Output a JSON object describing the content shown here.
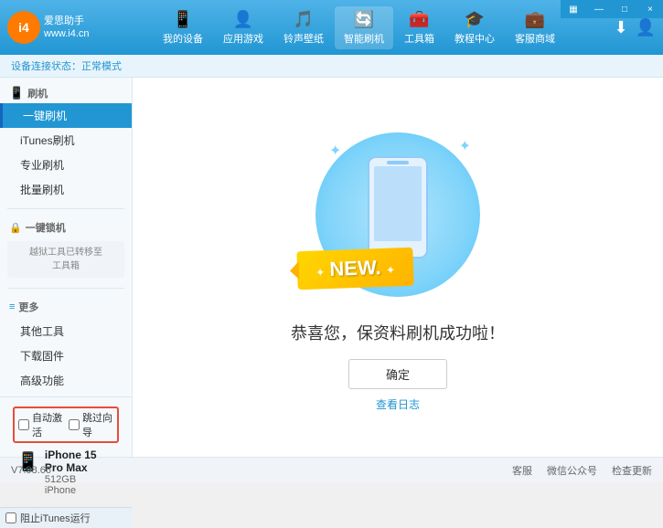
{
  "app": {
    "logo_text_line1": "爱思助手",
    "logo_text_line2": "www.i4.cn",
    "logo_abbr": "i4"
  },
  "nav": {
    "items": [
      {
        "id": "my-device",
        "label": "我的设备",
        "icon": "📱"
      },
      {
        "id": "apps-games",
        "label": "应用游戏",
        "icon": "👤"
      },
      {
        "id": "ringtones",
        "label": "铃声壁纸",
        "icon": "🎵"
      },
      {
        "id": "smart-flash",
        "label": "智能刷机",
        "icon": "🔄"
      },
      {
        "id": "toolbox",
        "label": "工具箱",
        "icon": "🧰"
      },
      {
        "id": "tutorials",
        "label": "教程中心",
        "icon": "🎓"
      },
      {
        "id": "service",
        "label": "客服商域",
        "icon": "💼"
      }
    ]
  },
  "window_controls": {
    "minimize": "—",
    "maximize": "□",
    "close": "×"
  },
  "breadcrumb": {
    "prefix": "设备连接状态：",
    "status": "正常模式"
  },
  "sidebar": {
    "flash_section": {
      "label": "刷机",
      "icon": "📱"
    },
    "items": [
      {
        "id": "one-click-flash",
        "label": "一键刷机",
        "active": true
      },
      {
        "id": "itunes-flash",
        "label": "iTunes刷机",
        "active": false
      },
      {
        "id": "pro-flash",
        "label": "专业刷机",
        "active": false
      },
      {
        "id": "batch-flash",
        "label": "批量刷机",
        "active": false
      }
    ],
    "notice_section": {
      "icon": "🔒",
      "label": "一键锁机",
      "notice_text": "越狱工具已转移至\n工具箱"
    },
    "more_section": {
      "label": "更多",
      "icon": "≡"
    },
    "more_items": [
      {
        "id": "other-tools",
        "label": "其他工具"
      },
      {
        "id": "download-firmware",
        "label": "下载固件"
      },
      {
        "id": "advanced",
        "label": "高级功能"
      }
    ],
    "auto_row": {
      "auto_activate": "自动激活",
      "auto_export": "跳过向导"
    },
    "device": {
      "name": "iPhone 15 Pro Max",
      "storage": "512GB",
      "type": "iPhone",
      "icon": "📱"
    },
    "itunes_bar": {
      "label": "阻止iTunes运行"
    }
  },
  "content": {
    "new_badge": "NEW.",
    "success_message": "恭喜您，保资料刷机成功啦！",
    "confirm_button": "确定",
    "view_log": "查看日志"
  },
  "footer": {
    "version": "V7.98.66",
    "links": [
      {
        "id": "customer",
        "label": "客服"
      },
      {
        "id": "wechat",
        "label": "微信公众号"
      },
      {
        "id": "check-update",
        "label": "检查更新"
      }
    ]
  }
}
